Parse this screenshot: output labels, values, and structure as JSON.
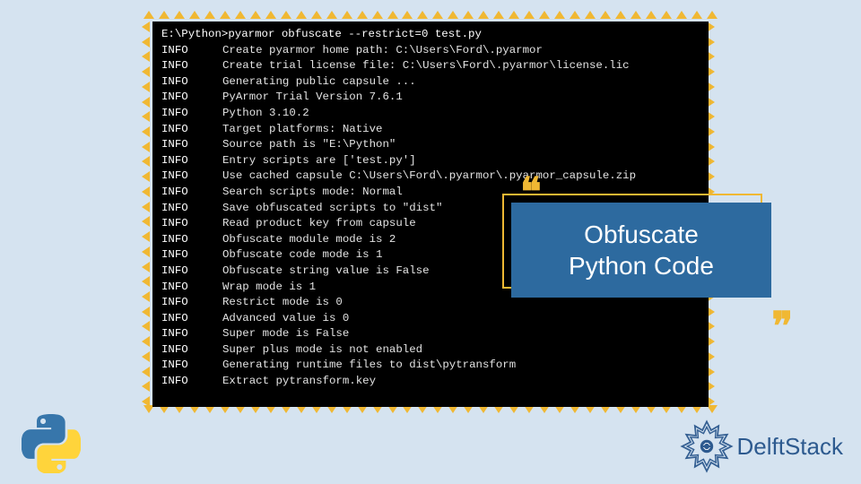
{
  "terminal": {
    "prompt": "E:\\Python>pyarmor obfuscate --restrict=0 test.py",
    "lines": [
      "Create pyarmor home path: C:\\Users\\Ford\\.pyarmor",
      "Create trial license file: C:\\Users\\Ford\\.pyarmor\\license.lic",
      "Generating public capsule ...",
      "PyArmor Trial Version 7.6.1",
      "Python 3.10.2",
      "Target platforms: Native",
      "Source path is \"E:\\Python\"",
      "Entry scripts are ['test.py']",
      "Use cached capsule C:\\Users\\Ford\\.pyarmor\\.pyarmor_capsule.zip",
      "Search scripts mode: Normal",
      "Save obfuscated scripts to \"dist\"",
      "Read product key from capsule",
      "Obfuscate module mode is 2",
      "Obfuscate code mode is 1",
      "Obfuscate string value is False",
      "Wrap mode is 1",
      "Restrict mode is 0",
      "Advanced value is 0",
      "Super mode is False",
      "Super plus mode is not enabled",
      "Generating runtime files to dist\\pytransform",
      "Extract pytransform.key"
    ],
    "info_label": "INFO"
  },
  "callout": {
    "line1": "Obfuscate",
    "line2": "Python Code"
  },
  "brand": {
    "name": "DelftStack"
  }
}
